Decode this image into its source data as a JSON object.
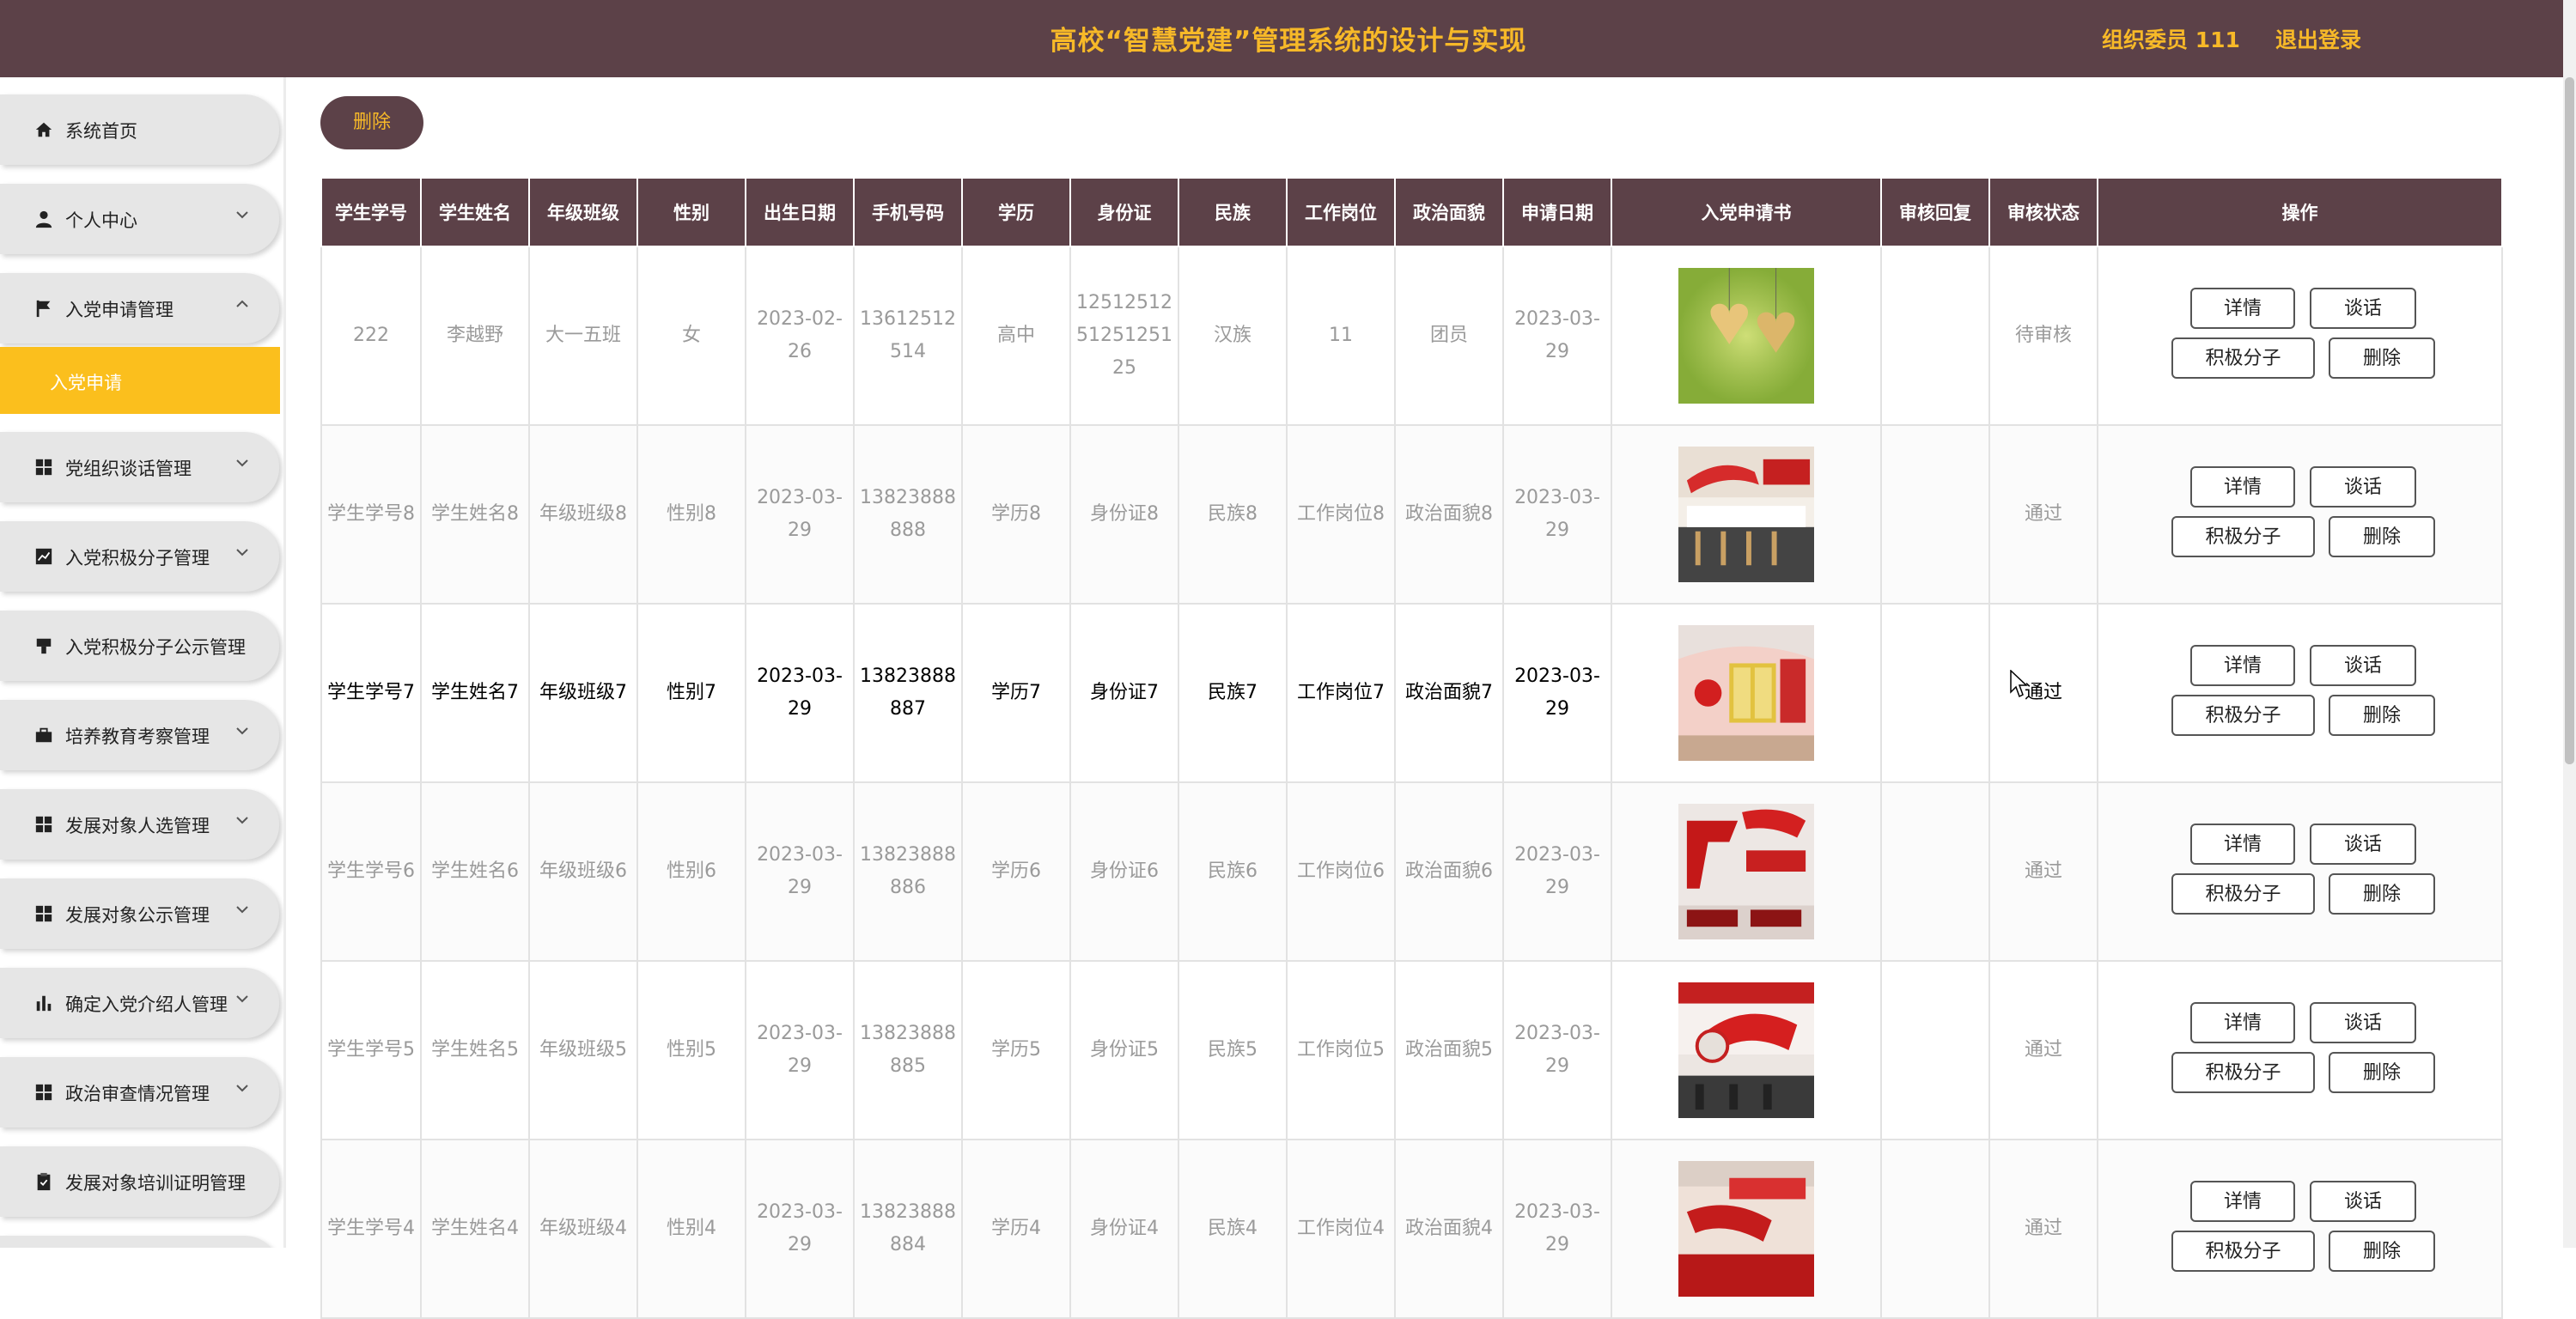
{
  "header": {
    "title": "高校“智慧党建”管理系统的设计与实现",
    "user": "组织委员 111",
    "logout": "退出登录"
  },
  "sidebar": {
    "items": [
      {
        "label": "系统首页",
        "icon": "home-icon"
      },
      {
        "label": "个人中心",
        "icon": "user-icon"
      },
      {
        "label": "入党申请管理",
        "icon": "flag-icon",
        "expanded": true
      },
      {
        "label": "入党申请",
        "sub": true
      },
      {
        "label": "党组织谈话管理",
        "icon": "grid-icon"
      },
      {
        "label": "入党积极分子管理",
        "icon": "chart-icon"
      },
      {
        "label": "入党积极分子公示管理",
        "icon": "stamp-icon"
      },
      {
        "label": "培养教育考察管理",
        "icon": "briefcase-icon"
      },
      {
        "label": "发展对象人选管理",
        "icon": "grid-icon"
      },
      {
        "label": "发展对象公示管理",
        "icon": "grid-icon"
      },
      {
        "label": "确定入党介绍人管理",
        "icon": "bar-chart-icon"
      },
      {
        "label": "政治审查情况管理",
        "icon": "grid-icon"
      },
      {
        "label": "发展对象培训证明管理",
        "icon": "clipboard-icon"
      }
    ]
  },
  "toolbar": {
    "delete_label": "删除"
  },
  "table": {
    "headers": [
      "学生学号",
      "学生姓名",
      "年级班级",
      "性别",
      "出生日期",
      "手机号码",
      "学历",
      "身份证",
      "民族",
      "工作岗位",
      "政治面貌",
      "申请日期",
      "入党申请书",
      "审核回复",
      "审核状态",
      "操作"
    ],
    "actions": {
      "detail": "详情",
      "talk": "谈话",
      "active": "积极分子",
      "delete": "删除"
    },
    "rows": [
      {
        "id": "222",
        "name": "李越野",
        "class": "大一五班",
        "gender": "女",
        "birth": "2023-02-26",
        "phone": "13612512514",
        "edu": "高中",
        "idcard": "125125125125125125",
        "ethnic": "汉族",
        "job": "11",
        "political": "团员",
        "apply_date": "2023-03-29",
        "image": "hearts-image",
        "reply": "",
        "status": "待审核"
      },
      {
        "id": "学生学号8",
        "name": "学生姓名8",
        "class": "年级班级8",
        "gender": "性别8",
        "birth": "2023-03-29",
        "phone": "13823888888",
        "edu": "学历8",
        "idcard": "身份证8",
        "ethnic": "民族8",
        "job": "工作岗位8",
        "political": "政治面貌8",
        "apply_date": "2023-03-29",
        "image": "party-wall-image",
        "reply": "",
        "status": "通过"
      },
      {
        "id": "学生学号7",
        "name": "学生姓名7",
        "class": "年级班级7",
        "gender": "性别7",
        "birth": "2023-03-29",
        "phone": "13823888887",
        "edu": "学历7",
        "idcard": "身份证7",
        "ethnic": "民族7",
        "job": "工作岗位7",
        "political": "政治面貌7",
        "apply_date": "2023-03-29",
        "image": "party-room-image",
        "reply": "",
        "status": "通过"
      },
      {
        "id": "学生学号6",
        "name": "学生姓名6",
        "class": "年级班级6",
        "gender": "性别6",
        "birth": "2023-03-29",
        "phone": "13823888886",
        "edu": "学历6",
        "idcard": "身份证6",
        "ethnic": "民族6",
        "job": "工作岗位6",
        "political": "政治面貌6",
        "apply_date": "2023-03-29",
        "image": "red-slogan-image",
        "reply": "",
        "status": "通过"
      },
      {
        "id": "学生学号5",
        "name": "学生姓名5",
        "class": "年级班级5",
        "gender": "性别5",
        "birth": "2023-03-29",
        "phone": "13823888885",
        "edu": "学历5",
        "idcard": "身份证5",
        "ethnic": "民族5",
        "job": "工作岗位5",
        "political": "政治面貌5",
        "apply_date": "2023-03-29",
        "image": "flag-hall-image",
        "reply": "",
        "status": "通过"
      },
      {
        "id": "学生学号4",
        "name": "学生姓名4",
        "class": "年级班级4",
        "gender": "性别4",
        "birth": "2023-03-29",
        "phone": "13823888884",
        "edu": "学历4",
        "idcard": "身份证4",
        "ethnic": "民族4",
        "job": "工作岗位4",
        "political": "政治面貌4",
        "apply_date": "2023-03-29",
        "image": "party-banner-image",
        "reply": "",
        "status": "通过"
      }
    ]
  },
  "colors": {
    "header_bg": "#5c4148",
    "accent": "#f7b928",
    "active_menu": "#fbbf1d"
  }
}
